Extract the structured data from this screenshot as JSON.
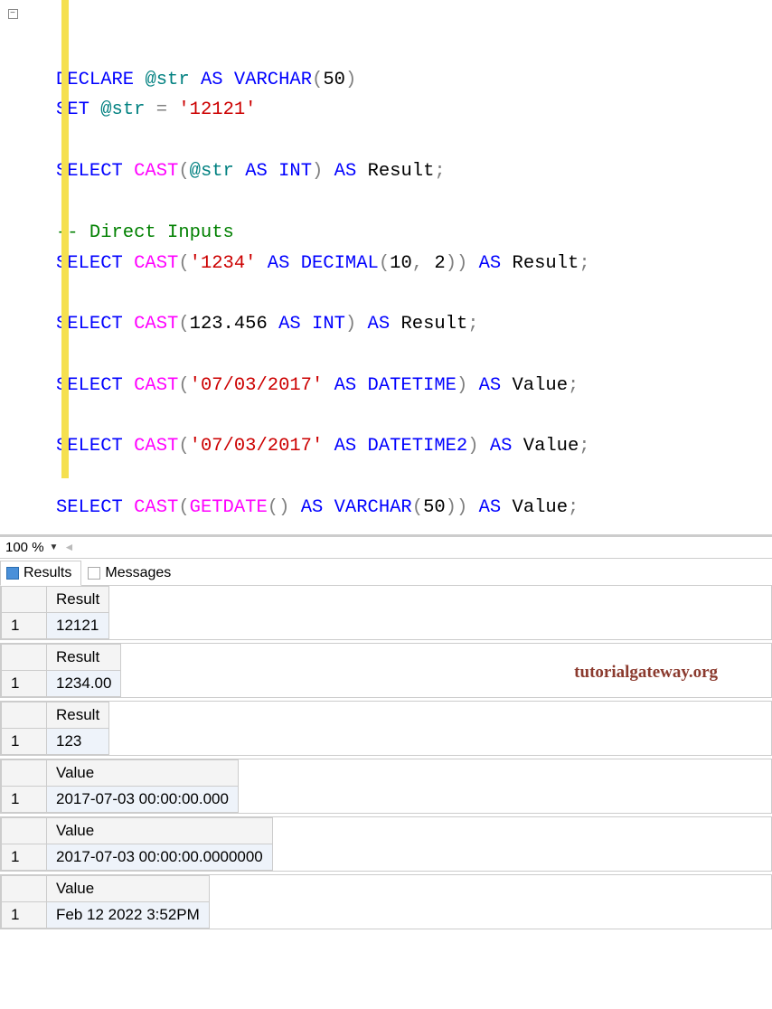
{
  "code": {
    "declare": "DECLARE",
    "str_var": "@str",
    "as": "AS",
    "varchar": "VARCHAR",
    "fifty": "50",
    "set": "SET",
    "eq": "=",
    "str_lit1": "'12121'",
    "select": "SELECT",
    "cast": "CAST",
    "int": "INT",
    "result_alias": "Result",
    "value_alias": "Value",
    "comment": "-- Direct Inputs",
    "lit_1234": "'1234'",
    "decimal": "DECIMAL",
    "ten": "10",
    "two": "2",
    "num_123456": "123.456",
    "lit_date": "'07/03/2017'",
    "datetime": "DATETIME",
    "datetime2": "DATETIME2",
    "getdate": "GETDATE",
    "semi": ";"
  },
  "zoom": {
    "level": "100 %"
  },
  "tabs": {
    "results": "Results",
    "messages": "Messages"
  },
  "results": [
    {
      "header": "Result",
      "row": "1",
      "value": "12121"
    },
    {
      "header": "Result",
      "row": "1",
      "value": "1234.00"
    },
    {
      "header": "Result",
      "row": "1",
      "value": "123"
    },
    {
      "header": "Value",
      "row": "1",
      "value": "2017-07-03 00:00:00.000"
    },
    {
      "header": "Value",
      "row": "1",
      "value": "2017-07-03 00:00:00.0000000"
    },
    {
      "header": "Value",
      "row": "1",
      "value": "Feb 12 2022  3:52PM"
    }
  ],
  "watermark": "tutorialgateway.org"
}
